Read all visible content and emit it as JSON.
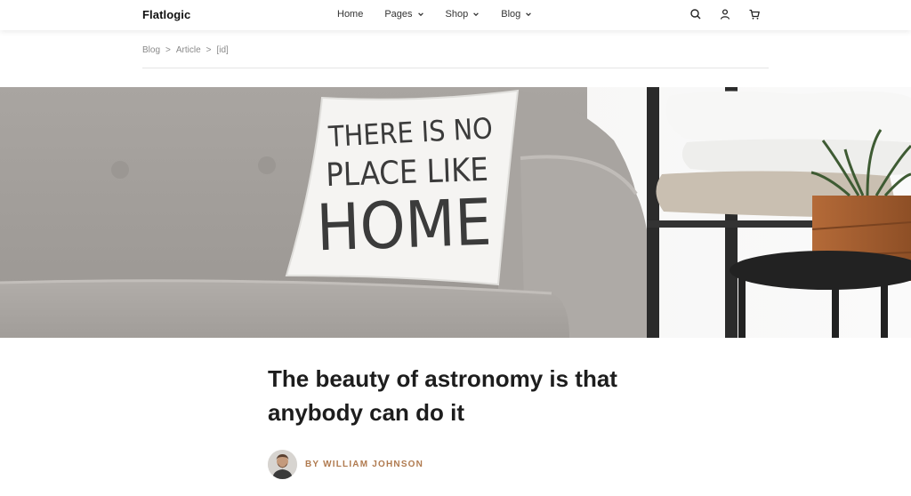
{
  "header": {
    "logo": "Flatlogic",
    "nav": [
      {
        "label": "Home",
        "has_dropdown": false
      },
      {
        "label": "Pages",
        "has_dropdown": true
      },
      {
        "label": "Shop",
        "has_dropdown": true
      },
      {
        "label": "Blog",
        "has_dropdown": true
      }
    ],
    "icons": [
      "search-icon",
      "user-icon",
      "cart-icon"
    ]
  },
  "breadcrumb": {
    "items": [
      "Blog",
      "Article",
      "[id]"
    ],
    "separator": ">"
  },
  "hero": {
    "pillow_text": [
      "THERE IS NO",
      "PLACE LIKE",
      "HOME"
    ]
  },
  "article": {
    "title": "The beauty of astronomy is that anybody can do it",
    "author": "BY WILLIAM JOHNSON"
  },
  "colors": {
    "accent": "#b07a4f",
    "text": "#1d1d1d",
    "muted": "#8a8a8a"
  }
}
